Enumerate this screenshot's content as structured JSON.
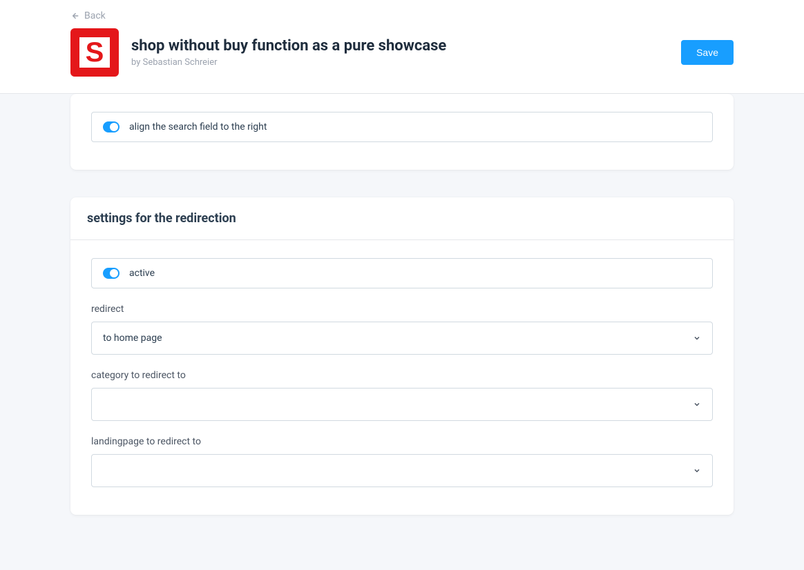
{
  "header": {
    "back_label": "Back",
    "title": "shop without buy function as a pure showcase",
    "byline": "by Sebastian Schreier",
    "save_label": "Save"
  },
  "section_top": {
    "toggles": {
      "align_search": {
        "label": "align the search field to the right",
        "enabled": true
      }
    }
  },
  "section_redirect": {
    "heading": "settings for the redirection",
    "toggles": {
      "active": {
        "label": "active",
        "enabled": true
      }
    },
    "fields": {
      "redirect": {
        "label": "redirect",
        "value": "to home page"
      },
      "category": {
        "label": "category to redirect to",
        "value": ""
      },
      "landingpage": {
        "label": "landingpage to redirect to",
        "value": ""
      }
    }
  }
}
